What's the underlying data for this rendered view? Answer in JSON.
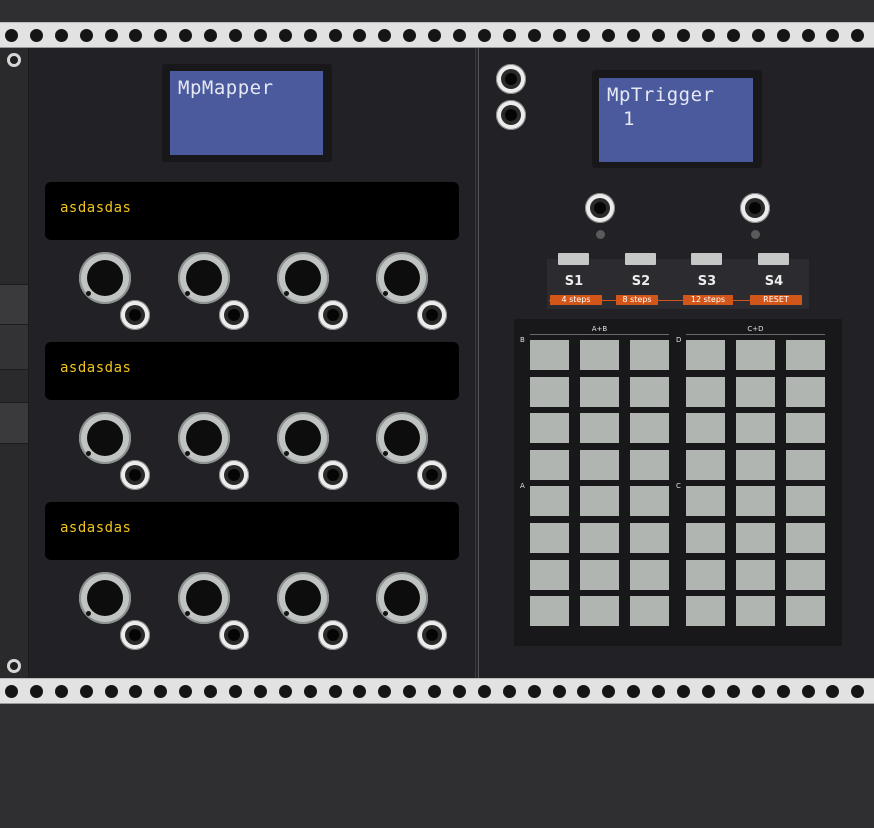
{
  "mapper": {
    "display_title": "MpMapper",
    "channels": [
      {
        "label": "asdasdas"
      },
      {
        "label": "asdasdas"
      },
      {
        "label": "asdasdas"
      }
    ]
  },
  "trigger": {
    "display_title": "MpTrigger",
    "display_value": "1",
    "steps": [
      {
        "name": "S1",
        "length": "4 steps"
      },
      {
        "name": "S2",
        "length": "8 steps"
      },
      {
        "name": "S3",
        "length": "12 steps"
      },
      {
        "name": "S4",
        "length": "RESET"
      }
    ],
    "groups": [
      {
        "title": "A+B"
      },
      {
        "title": "C+D"
      }
    ],
    "row_tags": [
      "B",
      "D",
      "A",
      "C"
    ]
  },
  "colors": {
    "lcd_bg": "#4a5a9d",
    "label_text": "#f0c419",
    "step_accent": "#d2561a",
    "pad": "#b0b5b2"
  }
}
